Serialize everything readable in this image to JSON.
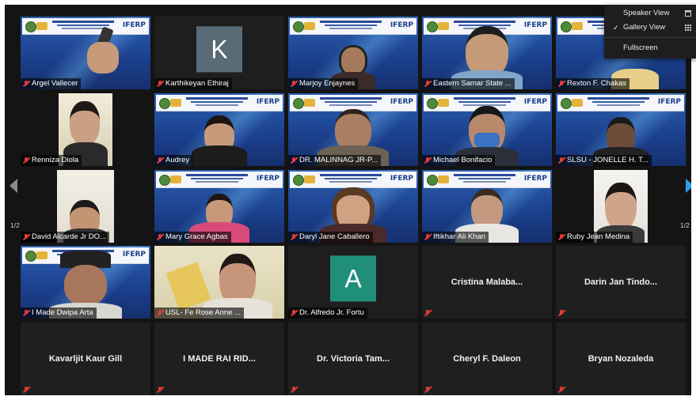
{
  "menu": {
    "items": [
      {
        "label": "Speaker View",
        "checked": false
      },
      {
        "label": "Gallery View",
        "checked": true
      },
      {
        "label": "Fullscreen",
        "checked": false
      }
    ]
  },
  "pager": {
    "left": "1/2",
    "right": "1/2"
  },
  "slide_logo": "IFERP",
  "participants": [
    {
      "name": "Argel Vallecer"
    },
    {
      "name": "Karthikeyan Ethiraj",
      "avatar_letter": "K"
    },
    {
      "name": "Marjoy Enjaynes"
    },
    {
      "name": "Eastern Samar State ..."
    },
    {
      "name": "Rexton F. Chakas"
    },
    {
      "name": "Renniza Diola"
    },
    {
      "name": "Audrey"
    },
    {
      "name": "DR. MALINNAG JR-P..."
    },
    {
      "name": "Michael Bonifacio"
    },
    {
      "name": "SLSU - JONELLE H. T..."
    },
    {
      "name": "David Alcarde Jr DO..."
    },
    {
      "name": "Mary Grace Agbas"
    },
    {
      "name": "Daryl Jane Caballero"
    },
    {
      "name": "Iftikhar Ali Khan"
    },
    {
      "name": "Ruby Jean Medina"
    },
    {
      "name": "I Made Dwipa Arta"
    },
    {
      "name": "USL- Fe Rose Anne ..."
    },
    {
      "name": "Dr. Alfredo Jr. Fortu",
      "avatar_letter": "A"
    },
    {
      "name": "Cristina  Malaba..."
    },
    {
      "name": "Darin Jan Tindo..."
    },
    {
      "name": "Kavarljit Kaur Gill"
    },
    {
      "name": "I MADE RAI RID..."
    },
    {
      "name": "Dr. Victoria Tam..."
    },
    {
      "name": "Cheryl F. Daleon"
    },
    {
      "name": "Bryan Nozaleda"
    }
  ],
  "colors": {
    "speaking_border": "#b9d44a",
    "muted_mic": "#e03b3b",
    "avatar_k": "#5a6b78",
    "avatar_a": "#1f8f7a",
    "arrow_left": "#8a8a8a",
    "arrow_right": "#2aa0e8"
  }
}
